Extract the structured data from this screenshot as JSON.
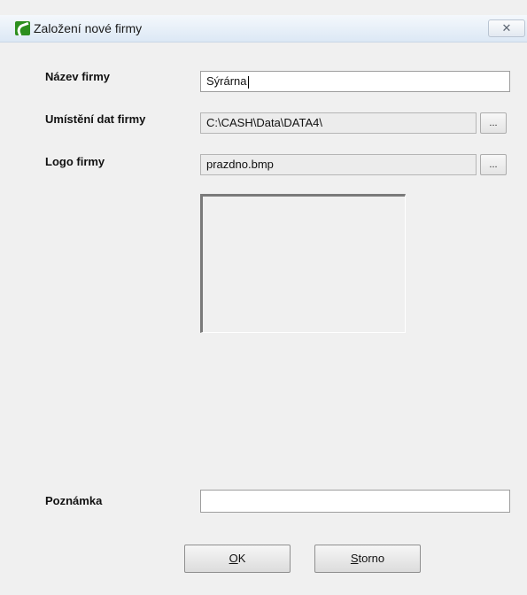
{
  "window": {
    "title": "Založení nové firmy",
    "close_label": "✕"
  },
  "form": {
    "name_label": "Název firmy",
    "name_value": "Sýrárna",
    "location_label": "Umístění dat firmy",
    "location_value": "C:\\CASH\\Data\\DATA4\\",
    "logo_label": "Logo firmy",
    "logo_value": "prazdno.bmp",
    "browse_label": "...",
    "note_label": "Poznámka",
    "note_value": ""
  },
  "buttons": {
    "ok_mnemonic": "O",
    "ok_rest": "K",
    "cancel_mnemonic": "S",
    "cancel_rest": "torno"
  },
  "icons": {
    "app": "app-logo-icon",
    "close": "close-icon"
  }
}
